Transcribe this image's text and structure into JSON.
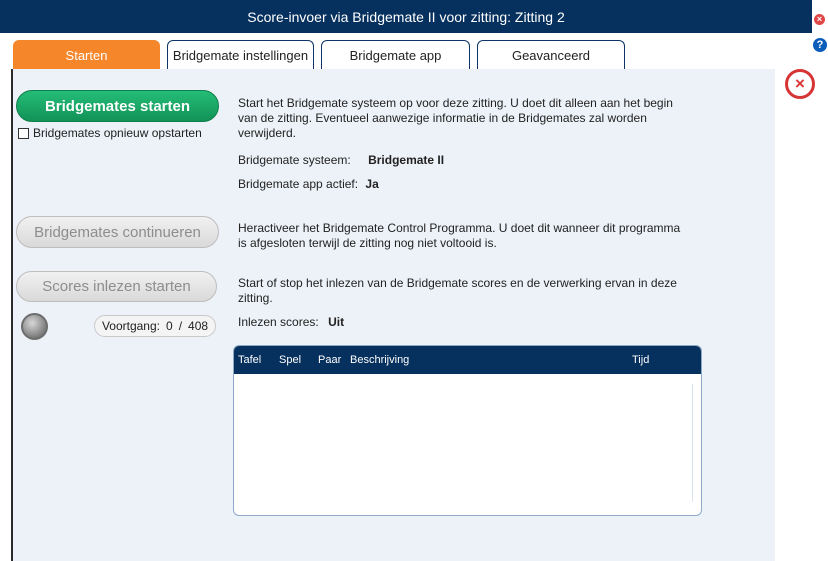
{
  "window": {
    "title": "Score-invoer via Bridgemate II voor zitting: Zitting 2",
    "close_glyph": "×",
    "help_glyph": "?",
    "dialog_close_glyph": "×"
  },
  "tabs": [
    {
      "label": "Starten",
      "active": true
    },
    {
      "label": "Bridgemate instellingen",
      "active": false
    },
    {
      "label": "Bridgemate app",
      "active": false
    },
    {
      "label": "Geavanceerd",
      "active": false
    }
  ],
  "start": {
    "button_label": "Bridgemates starten",
    "restart_checkbox_label": "Bridgemates opnieuw opstarten",
    "restart_checked": false,
    "description": "Start het Bridgemate systeem op voor deze zitting. U doet dit alleen aan het begin van de zitting. Eventueel aanwezige informatie in de Bridgemates zal worden verwijderd.",
    "system_label": "Bridgemate systeem:",
    "system_value": "Bridgemate II",
    "app_label": "Bridgemate app actief:",
    "app_value": "Ja"
  },
  "continue": {
    "button_label": "Bridgemates continueren",
    "description": "Heractiveer het Bridgemate Control Programma. U doet dit wanneer dit programma is afgesloten terwijl de zitting nog niet voltooid is."
  },
  "scores": {
    "button_label": "Scores inlezen starten",
    "description": "Start of stop het inlezen van de Bridgemate scores en de verwerking ervan in deze zitting.",
    "progress_label": "Voortgang:",
    "progress_current": "0",
    "progress_separator": "/",
    "progress_total": "408",
    "reading_label": "Inlezen scores:",
    "reading_value": "Uit"
  },
  "table": {
    "columns": [
      "Tafel",
      "Spel",
      "Paar",
      "Beschrijving",
      "Tijd"
    ],
    "rows": []
  },
  "colors": {
    "titlebar": "#06305e",
    "active_tab": "#f5862a",
    "start_button": "#19a866",
    "panel": "#edf2f8",
    "close": "#d73535"
  },
  "icons": {
    "window_close": "close-icon",
    "help": "help-icon",
    "dialog_close": "close-circle-icon",
    "status_led": "led-indicator-icon"
  }
}
